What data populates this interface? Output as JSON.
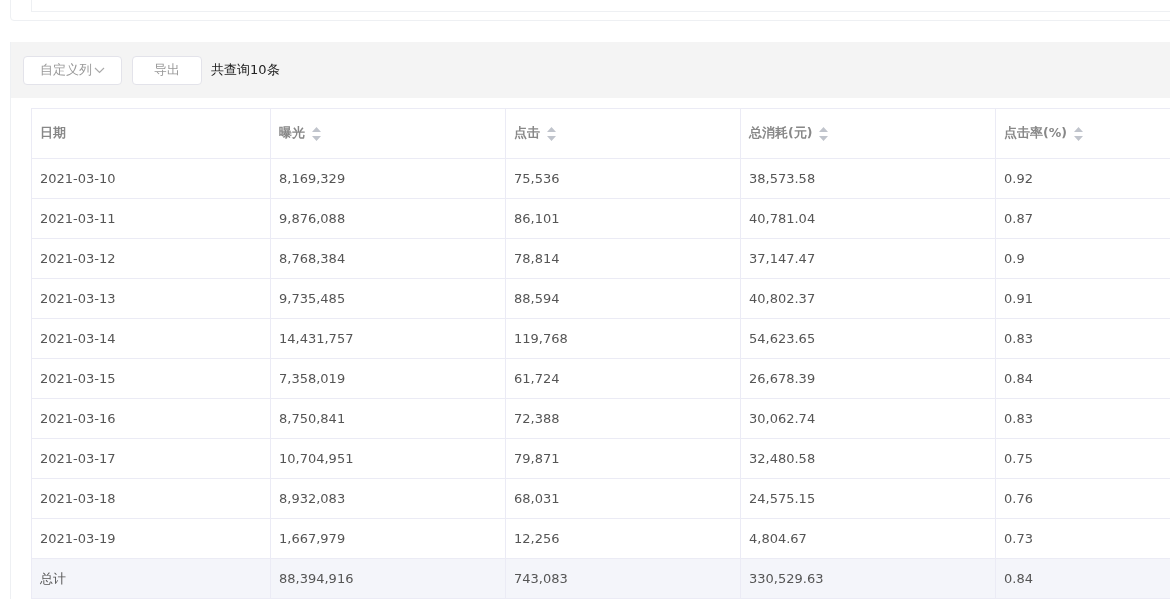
{
  "toolbar": {
    "column_button": "自定义列",
    "export_button": "导出",
    "result_count": "共查询10条"
  },
  "table": {
    "columns": [
      {
        "label": "日期",
        "sortable": false
      },
      {
        "label": "曝光",
        "sortable": true
      },
      {
        "label": "点击",
        "sortable": true
      },
      {
        "label": "总消耗(元)",
        "sortable": true
      },
      {
        "label": "点击率(%)",
        "sortable": true
      }
    ],
    "rows": [
      [
        "2021-03-10",
        "8,169,329",
        "75,536",
        "38,573.58",
        "0.92"
      ],
      [
        "2021-03-11",
        "9,876,088",
        "86,101",
        "40,781.04",
        "0.87"
      ],
      [
        "2021-03-12",
        "8,768,384",
        "78,814",
        "37,147.47",
        "0.9"
      ],
      [
        "2021-03-13",
        "9,735,485",
        "88,594",
        "40,802.37",
        "0.91"
      ],
      [
        "2021-03-14",
        "14,431,757",
        "119,768",
        "54,623.65",
        "0.83"
      ],
      [
        "2021-03-15",
        "7,358,019",
        "61,724",
        "26,678.39",
        "0.84"
      ],
      [
        "2021-03-16",
        "8,750,841",
        "72,388",
        "30,062.74",
        "0.83"
      ],
      [
        "2021-03-17",
        "10,704,951",
        "79,871",
        "32,480.58",
        "0.75"
      ],
      [
        "2021-03-18",
        "8,932,083",
        "68,031",
        "24,575.15",
        "0.76"
      ],
      [
        "2021-03-19",
        "1,667,979",
        "12,256",
        "4,804.67",
        "0.73"
      ]
    ],
    "total_row": [
      "总计",
      "88,394,916",
      "743,083",
      "330,529.63",
      "0.84"
    ]
  }
}
